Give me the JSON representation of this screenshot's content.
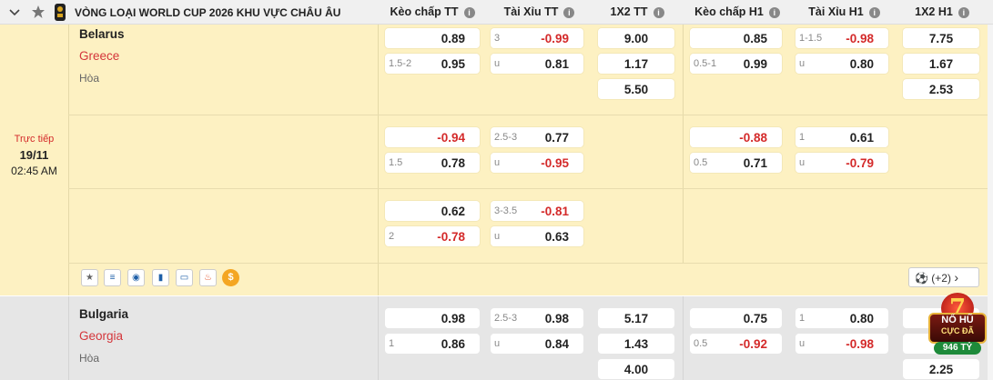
{
  "header": {
    "league": "VÒNG LOẠI WORLD CUP 2026 KHU VỰC CHÂU ÂU",
    "cols": [
      "Kèo chấp TT",
      "Tài Xỉu TT",
      "1X2 TT",
      "Kèo chấp H1",
      "Tài Xỉu H1",
      "1X2 H1"
    ],
    "info": "i"
  },
  "match1": {
    "status": "Trực tiếp",
    "date": "19/11",
    "time": "02:45 AM",
    "home": "Belarus",
    "away": "Greece",
    "draw": "Hòa",
    "rows": [
      {
        "hft": {
          "h1": "",
          "v1": "0.89",
          "h2": "1.5-2",
          "v2": "0.95"
        },
        "oft": {
          "h1": "3",
          "v1": "-0.99",
          "h2": "u",
          "v2": "0.81"
        },
        "x12ft": [
          "9.00",
          "1.17",
          "5.50"
        ],
        "hh1": {
          "h1": "",
          "v1": "0.85",
          "h2": "0.5-1",
          "v2": "0.99"
        },
        "oh1": {
          "h1": "1-1.5",
          "v1": "-0.98",
          "h2": "u",
          "v2": "0.80"
        },
        "x12h1": [
          "7.75",
          "1.67",
          "2.53"
        ]
      },
      {
        "hft": {
          "h1": "",
          "v1": "-0.94",
          "h2": "1.5",
          "v2": "0.78"
        },
        "oft": {
          "h1": "2.5-3",
          "v1": "0.77",
          "h2": "u",
          "v2": "-0.95"
        },
        "hh1": {
          "h1": "",
          "v1": "-0.88",
          "h2": "0.5",
          "v2": "0.71"
        },
        "oh1": {
          "h1": "1",
          "v1": "0.61",
          "h2": "u",
          "v2": "-0.79"
        }
      },
      {
        "hft": {
          "h1": "",
          "v1": "0.62",
          "h2": "2",
          "v2": "-0.78"
        },
        "oft": {
          "h1": "3-3.5",
          "v1": "-0.81",
          "h2": "u",
          "v2": "0.63"
        }
      }
    ],
    "more": "(+2)"
  },
  "match2": {
    "home": "Bulgaria",
    "away": "Georgia",
    "draw": "Hòa",
    "hft": {
      "h1": "",
      "v1": "0.98",
      "h2": "1",
      "v2": "0.86"
    },
    "oft": {
      "h1": "2.5-3",
      "v1": "0.98",
      "h2": "u",
      "v2": "0.84"
    },
    "x12ft": [
      "5.17",
      "1.43",
      "4.00"
    ],
    "hh1": {
      "h1": "",
      "v1": "0.75",
      "h2": "0.5",
      "v2": "-0.92"
    },
    "oh1": {
      "h1": "1",
      "v1": "0.80",
      "h2": "u",
      "v2": "-0.98"
    },
    "x12h1": [
      "",
      "",
      "2.25"
    ]
  },
  "badge": {
    "line1": "NỔ HŨ",
    "line2": "CỰC ĐÃ",
    "line3": "946 TỶ",
    "num": "7"
  },
  "colors": {
    "yellow": "#fdf1c2",
    "negative": "#d42a2a",
    "away": "#d4363b",
    "live": "#d42a2a"
  }
}
